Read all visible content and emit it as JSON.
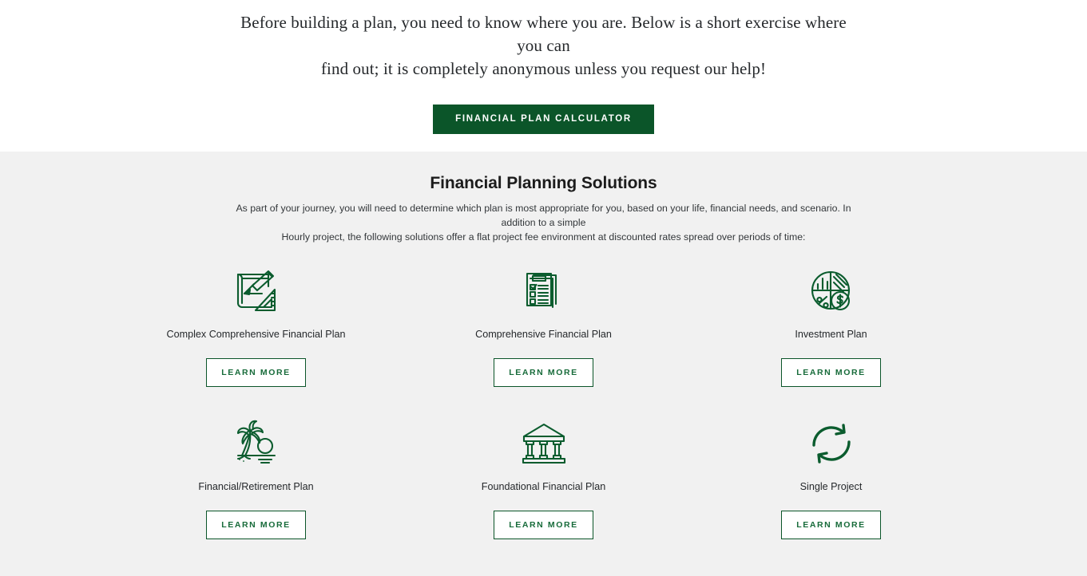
{
  "hero": {
    "intro_line1": "Before building a plan, you need to know where you are. Below is a short exercise where you can",
    "intro_line2": "find out;  it is completely anonymous unless you request our help!",
    "cta_label": "FINANCIAL PLAN CALCULATOR"
  },
  "solutions": {
    "title": "Financial Planning Solutions",
    "description_line1": "As part of your journey, you will need to determine which plan is most appropriate for you, based on your life, financial needs, and scenario. In addition to a simple",
    "description_line2": "Hourly project, the following solutions offer a flat project fee environment at discounted rates spread over periods of time:",
    "cards": [
      {
        "label": "Complex Comprehensive Financial Plan",
        "icon": "blueprint-pencil-ruler-icon",
        "button_label": "LEARN MORE"
      },
      {
        "label": "Comprehensive Financial Plan",
        "icon": "stacked-checklist-documents-icon",
        "button_label": "LEARN MORE"
      },
      {
        "label": "Investment Plan",
        "icon": "pie-chart-percent-dollar-icon",
        "button_label": "LEARN MORE"
      },
      {
        "label": "Financial/Retirement Plan",
        "icon": "palm-tree-sunset-icon",
        "button_label": "LEARN MORE"
      },
      {
        "label": "Foundational Financial Plan",
        "icon": "bank-columns-icon",
        "button_label": "LEARN MORE"
      },
      {
        "label": "Single Project",
        "icon": "circular-arrows-refresh-icon",
        "button_label": "LEARN MORE"
      }
    ]
  },
  "colors": {
    "brand_green": "#0b5529",
    "icon_green": "#0b5c2e",
    "link_green": "#176b3a",
    "section_background": "#f1f1f1",
    "page_background": "#ffffff",
    "heading_text": "#1c1c1c",
    "body_text": "#33373a"
  }
}
